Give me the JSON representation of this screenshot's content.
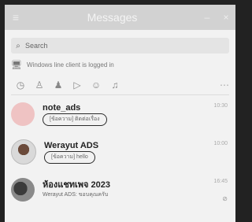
{
  "window": {
    "title": "Messages",
    "menu_icon": "≡",
    "minimize_icon": "–",
    "close_icon": "×"
  },
  "search": {
    "placeholder": "Search",
    "icon": "⌕"
  },
  "notice": {
    "icon": "🖥",
    "text": "Windows line client is logged in"
  },
  "filters": [
    {
      "name": "clock-icon",
      "glyph": "◷"
    },
    {
      "name": "person-icon",
      "glyph": "♙"
    },
    {
      "name": "group-icon",
      "glyph": "♟"
    },
    {
      "name": "send-icon",
      "glyph": "▷"
    },
    {
      "name": "bot-icon",
      "glyph": "☺"
    },
    {
      "name": "bell-icon",
      "glyph": "♫"
    }
  ],
  "filters_more": "⋯",
  "chats": [
    {
      "name": "note_ads",
      "preview": "[ข้อความ] ติดต่อเรื่อง",
      "time": "10:30"
    },
    {
      "name": "Werayut ADS",
      "preview": "[ข้อความ] hello",
      "time": "10:00"
    },
    {
      "name": "ห้องแชทเพจ 2023",
      "preview": "Werayut ADS: ขอบคุณครับ",
      "time": "16:45",
      "mute": "⊘"
    }
  ]
}
